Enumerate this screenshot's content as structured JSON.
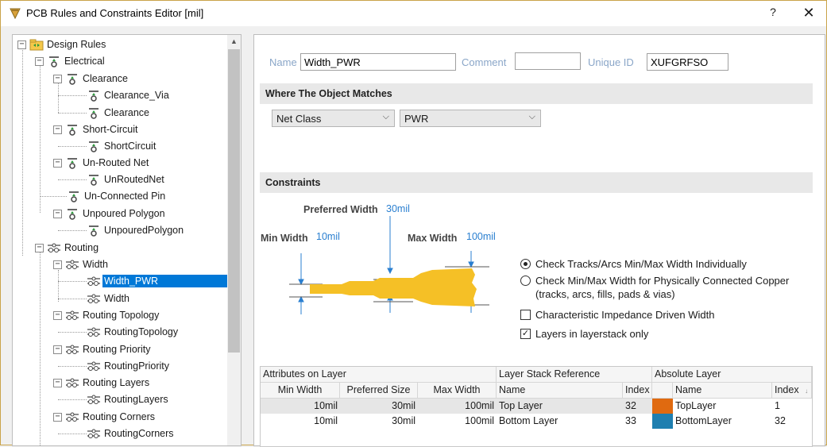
{
  "window": {
    "title": "PCB Rules and Constraints Editor [mil]",
    "help_label": "?",
    "close_label": "✕"
  },
  "tree": {
    "scroll_up": "▲",
    "items": [
      {
        "label": "Design Rules"
      },
      {
        "label": "Electrical"
      },
      {
        "label": "Clearance"
      },
      {
        "label": "Clearance_Via"
      },
      {
        "label": "Clearance"
      },
      {
        "label": "Short-Circuit"
      },
      {
        "label": "ShortCircuit"
      },
      {
        "label": "Un-Routed Net"
      },
      {
        "label": "UnRoutedNet"
      },
      {
        "label": "Un-Connected Pin"
      },
      {
        "label": "Unpoured Polygon"
      },
      {
        "label": "UnpouredPolygon"
      },
      {
        "label": "Routing"
      },
      {
        "label": "Width"
      },
      {
        "label": "Width_PWR"
      },
      {
        "label": "Width"
      },
      {
        "label": "Routing Topology"
      },
      {
        "label": "RoutingTopology"
      },
      {
        "label": "Routing Priority"
      },
      {
        "label": "RoutingPriority"
      },
      {
        "label": "Routing Layers"
      },
      {
        "label": "RoutingLayers"
      },
      {
        "label": "Routing Corners"
      },
      {
        "label": "RoutingCorners"
      }
    ]
  },
  "rule": {
    "name_label": "Name",
    "name_value": "Width_PWR",
    "comment_label": "Comment",
    "comment_value": "",
    "uid_label": "Unique ID",
    "uid_value": "XUFGRFSO"
  },
  "where": {
    "heading": "Where The Object Matches",
    "match_type": "Net Class",
    "match_value": "PWR"
  },
  "constraints": {
    "heading": "Constraints",
    "preferred_label": "Preferred Width",
    "preferred_value": "30mil",
    "min_label": "Min Width",
    "min_value": "10mil",
    "max_label": "Max Width",
    "max_value": "100mil",
    "options": [
      {
        "type": "radio",
        "checked": true,
        "label": "Check Tracks/Arcs Min/Max Width Individually"
      },
      {
        "type": "radio",
        "checked": false,
        "label": "Check Min/Max Width for Physically Connected Copper",
        "label2": "(tracks, arcs, fills, pads & vias)"
      },
      {
        "type": "check",
        "checked": false,
        "label": "Characteristic Impedance Driven Width"
      },
      {
        "type": "check",
        "checked": true,
        "label": "Layers in layerstack only"
      }
    ],
    "track_color": "#f5c026"
  },
  "grid": {
    "group_headers": [
      "Attributes on Layer",
      "Layer Stack Reference",
      "Absolute Layer"
    ],
    "columns": [
      "Min Width",
      "Preferred Size",
      "Max Width",
      "Name",
      "Index",
      "Name",
      "Index"
    ],
    "sort_icon": "↓",
    "rows": [
      {
        "min": "10mil",
        "pref": "30mil",
        "max": "100mil",
        "ref_name": "Top Layer",
        "ref_index": "32",
        "abs_color": "#e06a10",
        "abs_name": "TopLayer",
        "abs_index": "1"
      },
      {
        "min": "10mil",
        "pref": "30mil",
        "max": "100mil",
        "ref_name": "Bottom Layer",
        "ref_index": "33",
        "abs_color": "#1f7fb0",
        "abs_name": "BottomLayer",
        "abs_index": "32"
      }
    ]
  }
}
